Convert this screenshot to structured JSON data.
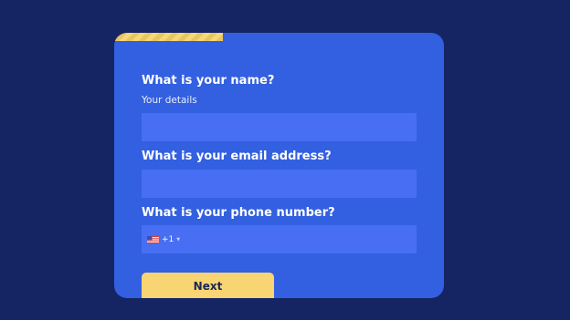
{
  "form": {
    "progress": 0.33,
    "name_question": "What is your name?",
    "name_sublabel": "Your details",
    "name_value": "",
    "email_question": "What is your email address?",
    "email_value": "",
    "phone_question": "What is your phone number?",
    "phone_country_icon": "us-flag-icon",
    "phone_dial_code": "+1",
    "phone_value": "",
    "next_label": "Next"
  },
  "colors": {
    "background": "#152563",
    "card": "#3360e0",
    "input": "#486ef4",
    "accent": "#f8d473"
  }
}
